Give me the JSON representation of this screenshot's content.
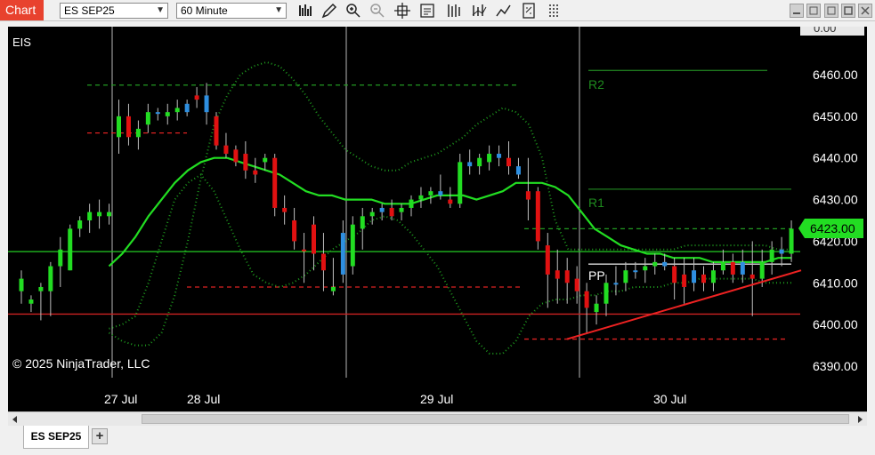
{
  "app": {
    "title": "Chart"
  },
  "toolbar": {
    "instrument": "ES SEP25",
    "interval": "60 Minute",
    "tools": [
      "bar-chart-icon",
      "pencil-icon",
      "zoom-in-icon",
      "zoom-out-icon",
      "crosshair-icon",
      "data-box-icon",
      "indicators-icon",
      "strategies-icon",
      "drawing-tools-icon",
      "properties-icon",
      "templates-icon"
    ]
  },
  "chart": {
    "instrument_label": "EIS",
    "copyright": "© 2025 NinjaTrader, LLC",
    "price_axis": [
      "6460.00",
      "6450.00",
      "6440.00",
      "6430.00",
      "6420.00",
      "6410.00",
      "6400.00",
      "6390.00"
    ],
    "top_partial_label": "0.00",
    "last_price": "6423.00",
    "last_price_color": "#22dd22",
    "date_labels": [
      "27 Jul",
      "28 Jul",
      "29 Jul",
      "30 Jul"
    ],
    "pivot_labels": {
      "r2": "R2",
      "r1": "R1",
      "pp": "PP"
    },
    "colors": {
      "up": "#22dd22",
      "down": "#e11111",
      "doji": "#2e8fe0",
      "ma": "#22dd22",
      "bands": "#1e9a1e"
    }
  },
  "chart_data": {
    "type": "candlestick",
    "instrument": "EIS",
    "ylim": [
      6385,
      6468
    ],
    "ylabels": [
      6460,
      6450,
      6440,
      6430,
      6420,
      6410,
      6400,
      6390
    ],
    "xlabels": [
      "27 Jul",
      "28 Jul",
      "29 Jul",
      "30 Jul"
    ],
    "last_price": 6423.0,
    "horizontal_levels": [
      {
        "name": "R2",
        "price": 6461.0,
        "color": "#1e7a1e",
        "style": "solid"
      },
      {
        "name": "R1",
        "price": 6432.5,
        "color": "#1e7a1e",
        "style": "solid"
      },
      {
        "name": "PP",
        "price": 6414.5,
        "color": "#dddddd",
        "style": "solid"
      },
      {
        "name": "green-line",
        "price": 6417.5,
        "color": "#22cc22",
        "style": "solid"
      },
      {
        "name": "red-line",
        "price": 6402.5,
        "color": "#cc2222",
        "style": "solid"
      },
      {
        "name": "session-high-1",
        "price": 6457.5,
        "color": "#229922",
        "style": "dashed"
      },
      {
        "name": "session-low-1",
        "price": 6446.0,
        "color": "#dd2222",
        "style": "dashed"
      },
      {
        "name": "session-low-2",
        "price": 6409.0,
        "color": "#dd2222",
        "style": "dashed"
      },
      {
        "name": "session-high-3",
        "price": 6423.0,
        "color": "#229922",
        "style": "dashed"
      },
      {
        "name": "session-low-3",
        "price": 6396.5,
        "color": "#dd2222",
        "style": "dashed"
      }
    ],
    "candles": [
      {
        "o": 6408,
        "h": 6413,
        "l": 6405,
        "c": 6411,
        "t": "up"
      },
      {
        "o": 6405,
        "h": 6407,
        "l": 6403,
        "c": 6406,
        "t": "up"
      },
      {
        "o": 6408,
        "h": 6410,
        "l": 6401,
        "c": 6409,
        "t": "up"
      },
      {
        "o": 6408,
        "h": 6415,
        "l": 6402,
        "c": 6414,
        "t": "up"
      },
      {
        "o": 6414,
        "h": 6421,
        "l": 6409,
        "c": 6418,
        "t": "up"
      },
      {
        "o": 6413,
        "h": 6424,
        "l": 6413,
        "c": 6423,
        "t": "up"
      },
      {
        "o": 6423,
        "h": 6426,
        "l": 6421,
        "c": 6425,
        "t": "up"
      },
      {
        "o": 6425,
        "h": 6429,
        "l": 6422,
        "c": 6427,
        "t": "up"
      },
      {
        "o": 6427,
        "h": 6430,
        "l": 6423,
        "c": 6426,
        "t": "up"
      },
      {
        "o": 6426,
        "h": 6429,
        "l": 6424,
        "c": 6427,
        "t": "up"
      },
      {
        "o": 6445,
        "h": 6454,
        "l": 6441,
        "c": 6450,
        "t": "up"
      },
      {
        "o": 6450,
        "h": 6453,
        "l": 6443,
        "c": 6445,
        "t": "down"
      },
      {
        "o": 6445,
        "h": 6449,
        "l": 6442,
        "c": 6447,
        "t": "up"
      },
      {
        "o": 6448,
        "h": 6453,
        "l": 6446,
        "c": 6451,
        "t": "up"
      },
      {
        "o": 6451,
        "h": 6452,
        "l": 6449,
        "c": 6451,
        "t": "doji"
      },
      {
        "o": 6450,
        "h": 6453,
        "l": 6448,
        "c": 6451,
        "t": "up"
      },
      {
        "o": 6451,
        "h": 6454,
        "l": 6449,
        "c": 6452,
        "t": "up"
      },
      {
        "o": 6451,
        "h": 6454,
        "l": 6450,
        "c": 6453,
        "t": "doji"
      },
      {
        "o": 6455,
        "h": 6457,
        "l": 6452,
        "c": 6454,
        "t": "down"
      },
      {
        "o": 6455,
        "h": 6458,
        "l": 6448,
        "c": 6451,
        "t": "doji"
      },
      {
        "o": 6450,
        "h": 6451,
        "l": 6442,
        "c": 6443,
        "t": "down"
      },
      {
        "o": 6443,
        "h": 6446,
        "l": 6440,
        "c": 6441,
        "t": "down"
      },
      {
        "o": 6442,
        "h": 6443,
        "l": 6438,
        "c": 6439,
        "t": "down"
      },
      {
        "o": 6441,
        "h": 6444,
        "l": 6435,
        "c": 6437,
        "t": "down"
      },
      {
        "o": 6437,
        "h": 6440,
        "l": 6434,
        "c": 6436,
        "t": "down"
      },
      {
        "o": 6439,
        "h": 6441,
        "l": 6437,
        "c": 6440,
        "t": "up"
      },
      {
        "o": 6440,
        "h": 6441,
        "l": 6426,
        "c": 6428,
        "t": "down"
      },
      {
        "o": 6428,
        "h": 6431,
        "l": 6424,
        "c": 6427,
        "t": "down"
      },
      {
        "o": 6425,
        "h": 6428,
        "l": 6418,
        "c": 6420,
        "t": "down"
      },
      {
        "o": 6418,
        "h": 6422,
        "l": 6410,
        "c": 6418,
        "t": "down"
      },
      {
        "o": 6424,
        "h": 6426,
        "l": 6413,
        "c": 6417,
        "t": "down"
      },
      {
        "o": 6417,
        "h": 6422,
        "l": 6408,
        "c": 6413,
        "t": "down"
      },
      {
        "o": 6408,
        "h": 6416,
        "l": 6407,
        "c": 6409,
        "t": "up"
      },
      {
        "o": 6412,
        "h": 6425,
        "l": 6410,
        "c": 6422,
        "t": "doji"
      },
      {
        "o": 6414,
        "h": 6426,
        "l": 6412,
        "c": 6424,
        "t": "up"
      },
      {
        "o": 6423,
        "h": 6428,
        "l": 6418,
        "c": 6426,
        "t": "up"
      },
      {
        "o": 6426,
        "h": 6428,
        "l": 6424,
        "c": 6427,
        "t": "up"
      },
      {
        "o": 6427,
        "h": 6429,
        "l": 6425,
        "c": 6428,
        "t": "doji"
      },
      {
        "o": 6428,
        "h": 6430,
        "l": 6425,
        "c": 6426,
        "t": "down"
      },
      {
        "o": 6427,
        "h": 6429,
        "l": 6425,
        "c": 6428,
        "t": "up"
      },
      {
        "o": 6428,
        "h": 6431,
        "l": 6426,
        "c": 6430,
        "t": "up"
      },
      {
        "o": 6430,
        "h": 6433,
        "l": 6428,
        "c": 6431,
        "t": "up"
      },
      {
        "o": 6431,
        "h": 6433,
        "l": 6429,
        "c": 6432,
        "t": "up"
      },
      {
        "o": 6432,
        "h": 6436,
        "l": 6430,
        "c": 6431,
        "t": "doji"
      },
      {
        "o": 6430,
        "h": 6433,
        "l": 6428,
        "c": 6429,
        "t": "down"
      },
      {
        "o": 6429,
        "h": 6441,
        "l": 6428,
        "c": 6439,
        "t": "up"
      },
      {
        "o": 6439,
        "h": 6442,
        "l": 6436,
        "c": 6438,
        "t": "doji"
      },
      {
        "o": 6438,
        "h": 6441,
        "l": 6436,
        "c": 6440,
        "t": "up"
      },
      {
        "o": 6439,
        "h": 6443,
        "l": 6437,
        "c": 6441,
        "t": "up"
      },
      {
        "o": 6441,
        "h": 6443,
        "l": 6438,
        "c": 6440,
        "t": "doji"
      },
      {
        "o": 6440,
        "h": 6444,
        "l": 6436,
        "c": 6438,
        "t": "down"
      },
      {
        "o": 6438,
        "h": 6440,
        "l": 6435,
        "c": 6436,
        "t": "doji"
      },
      {
        "o": 6432,
        "h": 6440,
        "l": 6425,
        "c": 6430,
        "t": "down"
      },
      {
        "o": 6432,
        "h": 6433,
        "l": 6418,
        "c": 6420,
        "t": "down"
      },
      {
        "o": 6419,
        "h": 6422,
        "l": 6404,
        "c": 6412,
        "t": "down"
      },
      {
        "o": 6413,
        "h": 6418,
        "l": 6405,
        "c": 6411,
        "t": "down"
      },
      {
        "o": 6413,
        "h": 6416,
        "l": 6405,
        "c": 6410,
        "t": "down"
      },
      {
        "o": 6411,
        "h": 6414,
        "l": 6405,
        "c": 6408,
        "t": "down"
      },
      {
        "o": 6408,
        "h": 6410,
        "l": 6398,
        "c": 6404,
        "t": "down"
      },
      {
        "o": 6403,
        "h": 6407,
        "l": 6400,
        "c": 6405,
        "t": "up"
      },
      {
        "o": 6405,
        "h": 6412,
        "l": 6402,
        "c": 6410,
        "t": "up"
      },
      {
        "o": 6410,
        "h": 6414,
        "l": 6407,
        "c": 6410,
        "t": "doji"
      },
      {
        "o": 6410,
        "h": 6415,
        "l": 6408,
        "c": 6413,
        "t": "up"
      },
      {
        "o": 6413,
        "h": 6415,
        "l": 6411,
        "c": 6413,
        "t": "doji"
      },
      {
        "o": 6413,
        "h": 6416,
        "l": 6410,
        "c": 6414,
        "t": "up"
      },
      {
        "o": 6414,
        "h": 6417,
        "l": 6412,
        "c": 6415,
        "t": "up"
      },
      {
        "o": 6415,
        "h": 6417,
        "l": 6413,
        "c": 6414,
        "t": "doji"
      },
      {
        "o": 6414,
        "h": 6416,
        "l": 6406,
        "c": 6410,
        "t": "down"
      },
      {
        "o": 6412,
        "h": 6416,
        "l": 6405,
        "c": 6409,
        "t": "down"
      },
      {
        "o": 6410,
        "h": 6416,
        "l": 6408,
        "c": 6413,
        "t": "doji"
      },
      {
        "o": 6412,
        "h": 6414,
        "l": 6408,
        "c": 6410,
        "t": "down"
      },
      {
        "o": 6410,
        "h": 6415,
        "l": 6408,
        "c": 6413,
        "t": "up"
      },
      {
        "o": 6413,
        "h": 6418,
        "l": 6412,
        "c": 6415,
        "t": "up"
      },
      {
        "o": 6415,
        "h": 6417,
        "l": 6410,
        "c": 6412,
        "t": "down"
      },
      {
        "o": 6412,
        "h": 6418,
        "l": 6410,
        "c": 6415,
        "t": "doji"
      },
      {
        "o": 6412,
        "h": 6420,
        "l": 6402,
        "c": 6411,
        "t": "down"
      },
      {
        "o": 6411,
        "h": 6418,
        "l": 6409,
        "c": 6415,
        "t": "up"
      },
      {
        "o": 6415,
        "h": 6420,
        "l": 6412,
        "c": 6418,
        "t": "up"
      },
      {
        "o": 6418,
        "h": 6421,
        "l": 6414,
        "c": 6417,
        "t": "doji"
      },
      {
        "o": 6417,
        "h": 6425,
        "l": 6415,
        "c": 6423,
        "t": "up"
      }
    ],
    "ma": [
      6414,
      6417,
      6421,
      6426,
      6430,
      6434,
      6437,
      6439,
      6440,
      6440,
      6439,
      6438,
      6437,
      6436,
      6434,
      6432,
      6431,
      6431,
      6430,
      6430,
      6430,
      6429,
      6429,
      6429,
      6430,
      6431,
      6431,
      6431,
      6430,
      6431,
      6432,
      6434,
      6434,
      6434,
      6433,
      6431,
      6427,
      6423,
      6421,
      6419,
      6418,
      6417,
      6417,
      6416,
      6416,
      6416,
      6415,
      6415,
      6415,
      6415,
      6415,
      6416,
      6416
    ],
    "upper_band": [
      6398,
      6396,
      6395,
      6395,
      6398,
      6407,
      6420,
      6435,
      6448,
      6455,
      6460,
      6462,
      6463,
      6462,
      6459,
      6455,
      6450,
      6446,
      6442,
      6440,
      6438,
      6437,
      6437,
      6439,
      6440,
      6441,
      6443,
      6445,
      6448,
      6450,
      6452,
      6451,
      6448,
      6440,
      6425,
      6418,
      6418,
      6418,
      6418,
      6418,
      6418,
      6418,
      6418,
      6418,
      6419,
      6419,
      6419,
      6419,
      6419,
      6419,
      6419,
      6418,
      6418
    ],
    "lower_band": [
      6399,
      6400,
      6402,
      6410,
      6420,
      6430,
      6434,
      6436,
      6432,
      6425,
      6418,
      6412,
      6410,
      6409,
      6410,
      6412,
      6415,
      6418,
      6420,
      6422,
      6425,
      6426,
      6425,
      6422,
      6418,
      6414,
      6408,
      6402,
      6396,
      6393,
      6393,
      6396,
      6402,
      6405,
      6406,
      6406,
      6407,
      6407,
      6408,
      6408,
      6409,
      6409,
      6409,
      6410,
      6410,
      6411,
      6411,
      6411,
      6411,
      6411,
      6410,
      6410,
      6410
    ],
    "trendline": {
      "from_price": 6396.5,
      "to_price": 6413.0,
      "color": "#ee2222"
    }
  }
}
